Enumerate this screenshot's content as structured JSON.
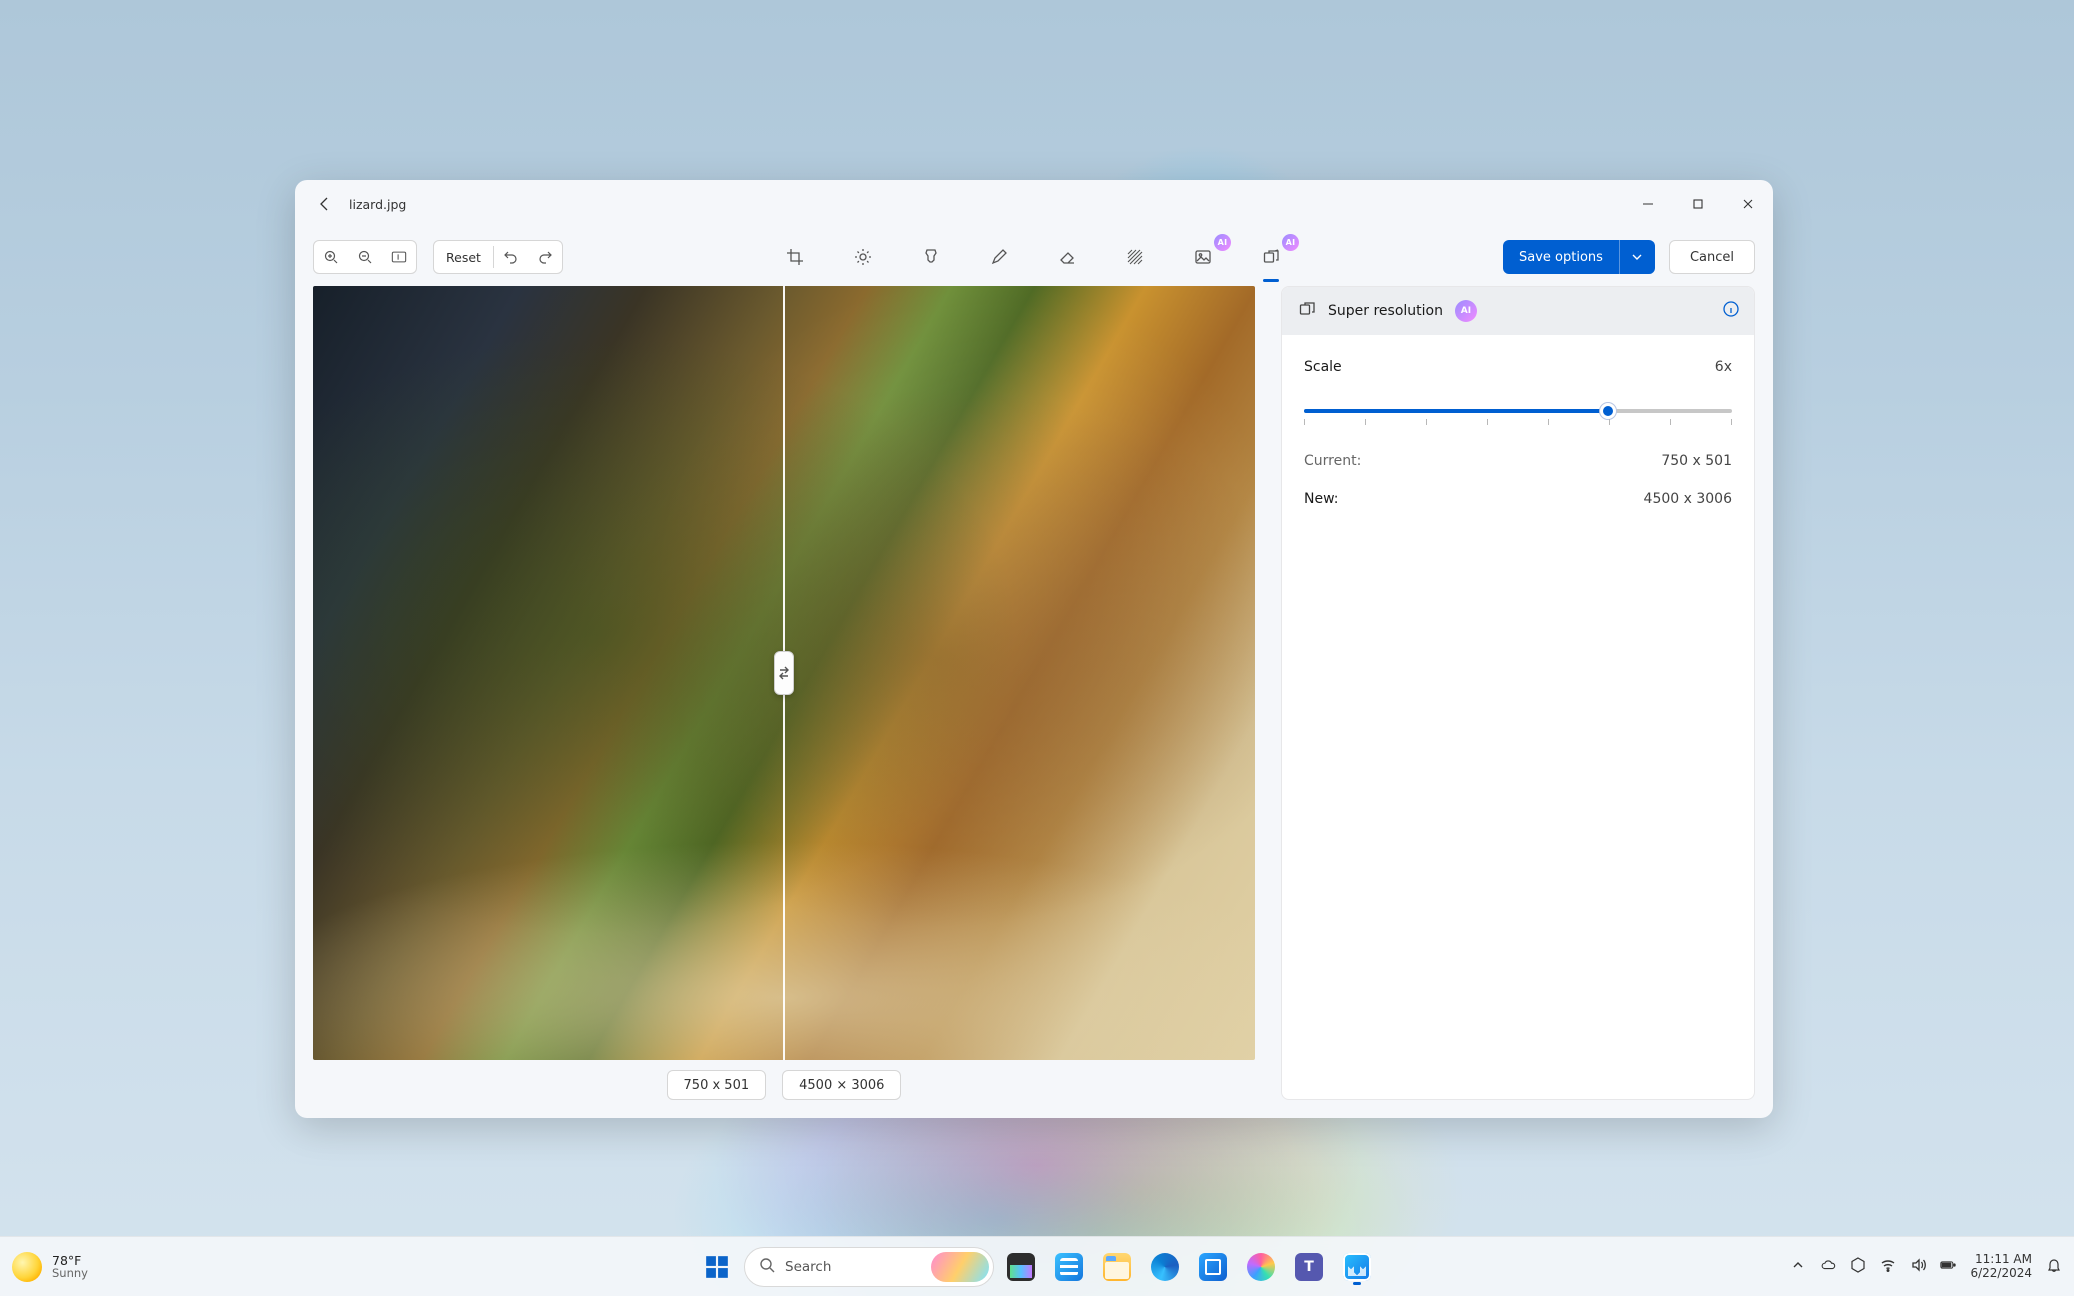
{
  "window": {
    "filename": "lizard.jpg"
  },
  "toolbar": {
    "reset_label": "Reset",
    "save_label": "Save options",
    "cancel_label": "Cancel"
  },
  "canvas": {
    "left_dim": "750 x 501",
    "right_dim": "4500 × 3006"
  },
  "panel": {
    "title": "Super resolution",
    "ai_badge": "AI",
    "scale_label": "Scale",
    "scale_value": "6x",
    "scale_percent": 71,
    "current_label": "Current:",
    "current_value": "750 x 501",
    "new_label": "New:",
    "new_value": "4500 x 3006"
  },
  "taskbar": {
    "search_placeholder": "Search",
    "weather_temp": "78°F",
    "weather_desc": "Sunny",
    "time": "11:11 AM",
    "date": "6/22/2024"
  }
}
